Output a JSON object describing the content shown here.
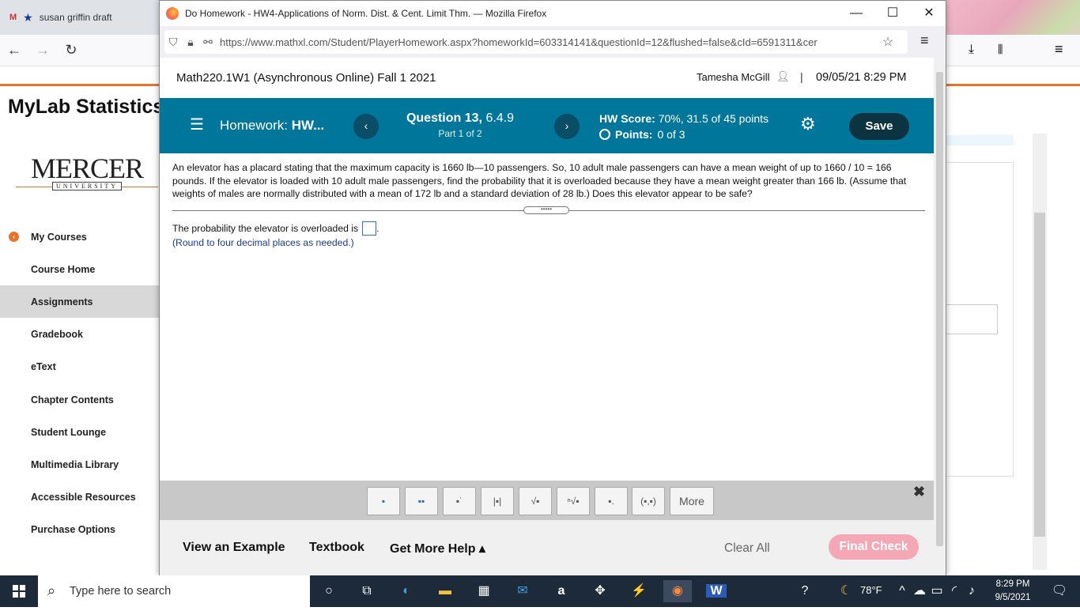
{
  "bg_browser": {
    "tab_title": "susan griffin draft",
    "brand_title": "MyLab Statistics",
    "logo_main": "MERCER",
    "logo_sub": "UNIVERSITY"
  },
  "sidebar": {
    "items": [
      {
        "label": "My Courses"
      },
      {
        "label": "Course Home"
      },
      {
        "label": "Assignments"
      },
      {
        "label": "Gradebook"
      },
      {
        "label": "eText"
      },
      {
        "label": "Chapter Contents"
      },
      {
        "label": "Student Lounge"
      },
      {
        "label": "Multimedia Library"
      },
      {
        "label": "Accessible Resources"
      },
      {
        "label": "Purchase Options"
      }
    ]
  },
  "popup": {
    "window_title": "Do Homework - HW4-Applications of Norm. Dist. & Cent. Limit Thm. — Mozilla Firefox",
    "url": "https://www.mathxl.com/Student/PlayerHomework.aspx?homeworkId=603314141&questionId=12&flushed=false&cId=6591311&cer"
  },
  "page": {
    "course_title": "Math220.1W1 (Asynchronous Online) Fall 1 2021",
    "user_name": "Tamesha McGill",
    "separator": "|",
    "datetime": "09/05/21 8:29 PM",
    "homework_label": "Homework:",
    "homework_name": "HW...",
    "question_label": "Question 13,",
    "question_number": "6.4.9",
    "part": "Part 1 of 2",
    "hw_score_label": "HW Score:",
    "hw_score_value": "70%, 31.5 of 45 points",
    "points_label": "Points:",
    "points_value": "0 of 3",
    "save_label": "Save",
    "question_text": "An elevator has a placard stating that the maximum capacity is 1660 lb—10 passengers. So, 10 adult male passengers can have a mean weight of up to 1660 / 10 = 166 pounds. If the elevator is loaded with 10 adult male passengers, find the probability that it is overloaded because they have a mean weight greater than 166 lb. (Assume that weights of males are normally distributed with a mean of 172 lb and a standard deviation of 28 lb.) Does this elevator appear to be safe?",
    "answer_prompt": "The probability the elevator is overloaded is",
    "answer_suffix": ".",
    "round_note": "(Round to four decimal places as needed.)",
    "toolbar_more": "More",
    "footer": {
      "view_example": "View an Example",
      "textbook": "Textbook",
      "more_help": "Get More Help ▴",
      "clear_all": "Clear All",
      "final_check": "Final Check"
    }
  },
  "taskbar": {
    "search_placeholder": "Type here to search",
    "weather": "78°F",
    "time": "8:29 PM",
    "date": "9/5/2021"
  },
  "colors": {
    "header_teal": "#00769b",
    "save_dark": "#0c3340",
    "final_check_pink": "#f4a7b5",
    "accent_orange": "#e8732a"
  }
}
